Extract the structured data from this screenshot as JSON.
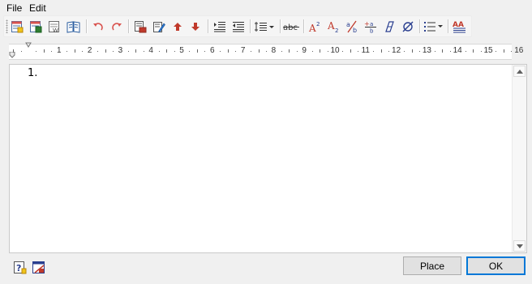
{
  "menu": {
    "file": "File",
    "edit": "Edit"
  },
  "toolbar": {
    "icons": [
      "new-style-icon",
      "save-style-icon",
      "edit-style-icon",
      "book-icon",
      "undo-icon",
      "redo-icon",
      "select-all-icon",
      "edit-text-icon",
      "move-up-icon",
      "move-down-icon",
      "indent-left-icon",
      "indent-right-icon",
      "line-spacing-icon",
      "strikethrough-icon",
      "superscript-icon",
      "subscript-icon",
      "fraction-icon",
      "stacked-fraction-icon",
      "oblique-icon",
      "diameter-icon",
      "numbered-list-icon",
      "text-style-icon"
    ]
  },
  "ruler": {
    "numbers": [
      "1",
      "2",
      "3",
      "4",
      "5",
      "6",
      "7",
      "8",
      "9",
      "10",
      "11",
      "12",
      "13",
      "14",
      "15",
      "16"
    ]
  },
  "editor": {
    "text": "1."
  },
  "footer": {
    "place_label": "Place",
    "ok_label": "OK"
  }
}
